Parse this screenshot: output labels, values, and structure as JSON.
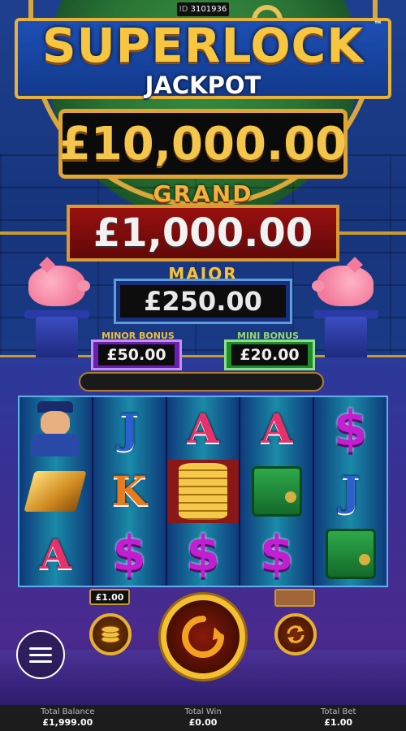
{
  "id_badge": {
    "label": "ID",
    "value": "3101936"
  },
  "logo": {
    "title": "SUPERLOCK",
    "subtitle": "JACKPOT",
    "trademark": "™"
  },
  "jackpots": {
    "super": "£10,000.00",
    "grand": {
      "label": "GRAND",
      "value": "£1,000.00"
    },
    "major": {
      "label": "MAJOR",
      "value": "£250.00"
    },
    "minor": {
      "label": "MINOR BONUS",
      "value": "£50.00"
    },
    "mini": {
      "label": "MINI BONUS",
      "value": "£20.00"
    }
  },
  "reels": [
    [
      "police-officer",
      "gold-bars",
      "A"
    ],
    [
      "J",
      "K",
      "$"
    ],
    [
      "A",
      "gold-coins",
      "$"
    ],
    [
      "A",
      "green-safe",
      "$"
    ],
    [
      "$",
      "J",
      "green-safe"
    ]
  ],
  "controls": {
    "bet_chip": "£1.00",
    "coin_button": "coin-stack-icon",
    "spin_button": "spin-icon",
    "autoplay_button": "autoplay-icon",
    "menu_button": "hamburger-menu-icon"
  },
  "footer": {
    "balance_label": "Total Balance",
    "balance_value": "£1,999.00",
    "win_label": "Total Win",
    "win_value": "£0.00",
    "bet_label": "Total Bet",
    "bet_value": "£1.00"
  },
  "colors": {
    "gold": "#e0a534",
    "grand_red": "#9a1010",
    "minor_purple": "#6b1fb0",
    "mini_green": "#1e8a2a"
  }
}
